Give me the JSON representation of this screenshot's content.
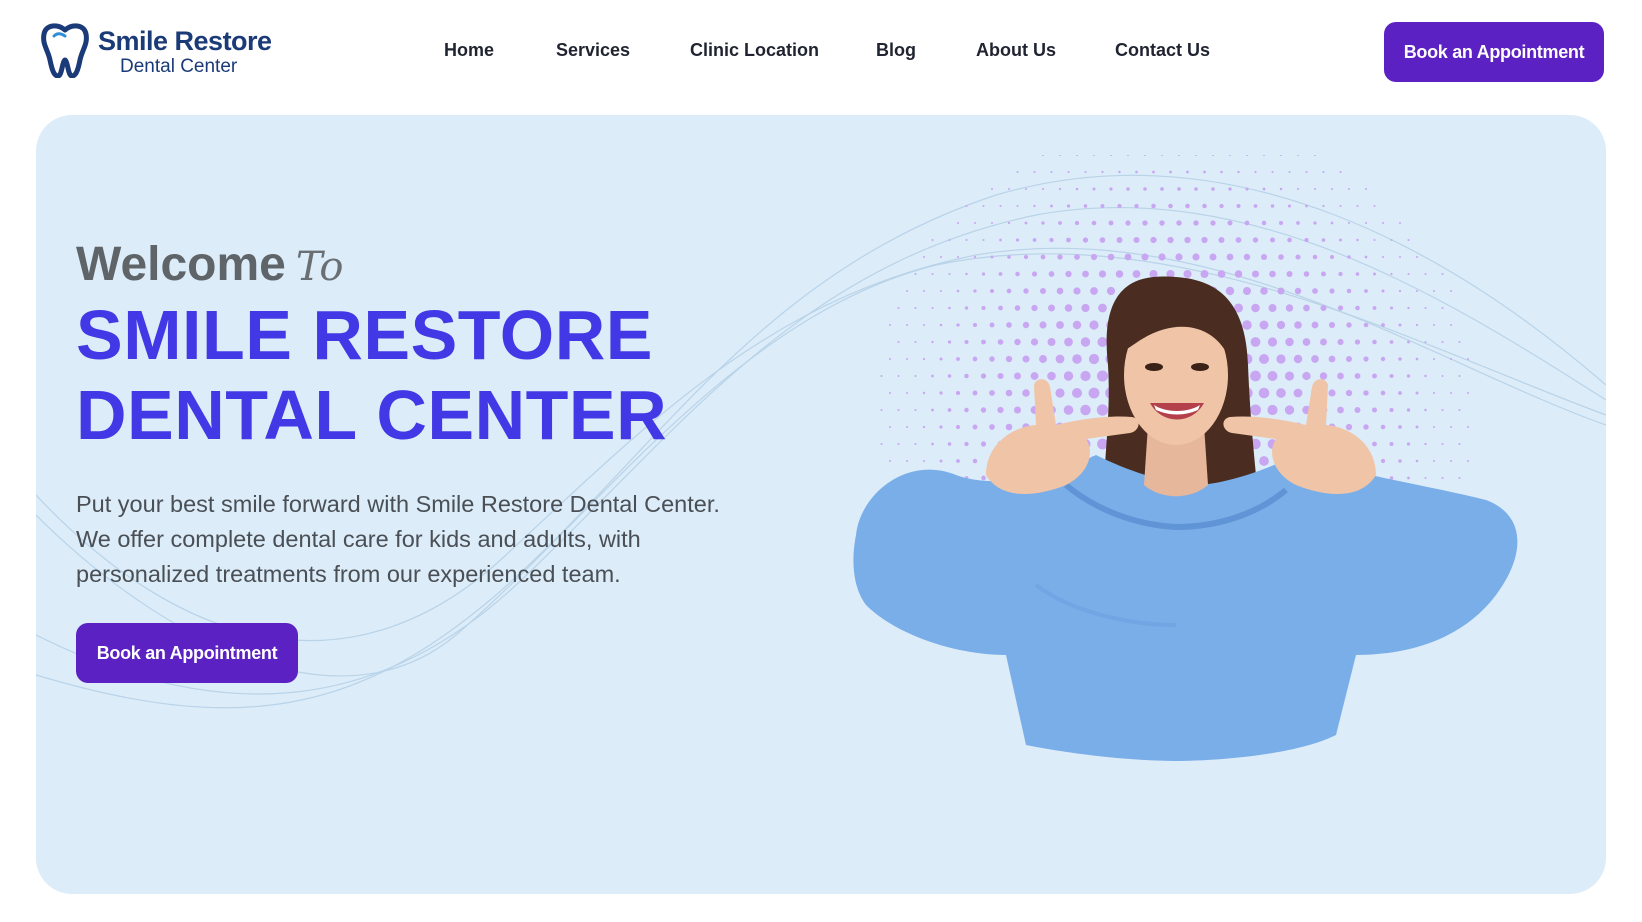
{
  "brand": {
    "name": "Smile Restore",
    "subtitle": "Dental Center",
    "logo_icon": "tooth-icon"
  },
  "nav": {
    "items": [
      {
        "label": "Home"
      },
      {
        "label": "Services"
      },
      {
        "label": "Clinic Location"
      },
      {
        "label": "Blog"
      },
      {
        "label": "About Us"
      },
      {
        "label": "Contact Us"
      }
    ],
    "cta_label": "Book an Appointment"
  },
  "hero": {
    "welcome": "Welcome",
    "welcome_script": "To",
    "title_line1": "SMILE RESTORE",
    "title_line2": "DENTAL CENTER",
    "description": "Put your best smile forward with Smile Restore Dental Center. We offer complete dental care for kids and adults, with personalized treatments from our experienced team.",
    "cta_label": "Book an Appointment",
    "image": "smiling-woman-pointing-at-smile"
  },
  "colors": {
    "brand_navy": "#1b3a78",
    "accent_purple": "#5b21c2",
    "title_blue": "#4338e5",
    "hero_bg": "#dcecf9",
    "dot_pattern": "#c9a6f2",
    "hoodie": "#7aaee8"
  }
}
